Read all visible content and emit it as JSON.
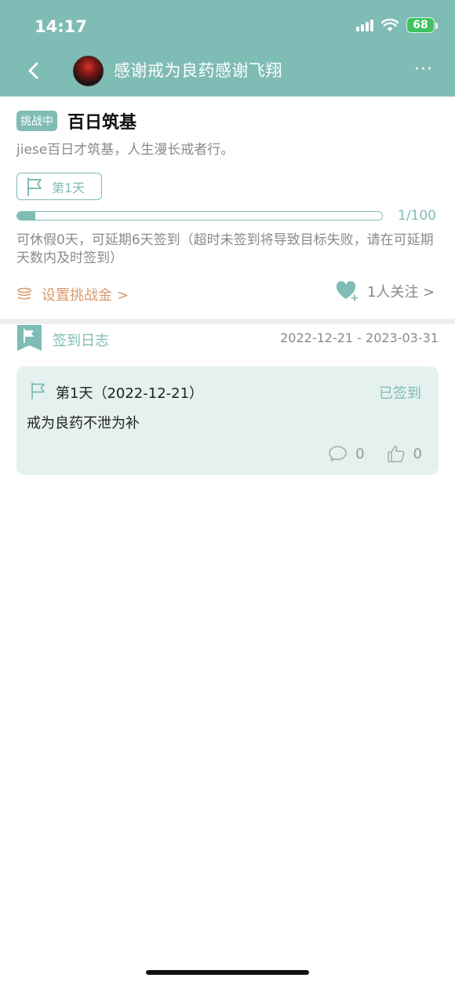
{
  "status_bar": {
    "time": "14:17",
    "battery": "68"
  },
  "nav": {
    "title": "感谢戒为良药感谢飞翔"
  },
  "challenge": {
    "tag": "挑战中",
    "title": "百日筑基",
    "description": "jiese百日才筑基，人生漫长戒者行。",
    "day_label": "第1天",
    "progress_text": "1/100",
    "progress_fraction": 0.05,
    "notice": "可休假0天，可延期6天签到（超时未签到将导致目标失败，请在可延期天数内及时签到）",
    "set_money": "设置挑战金 >",
    "follow": "1人关注 >"
  },
  "log": {
    "title": "签到日志",
    "date_range": "2022-12-21 - 2023-03-31",
    "entries": [
      {
        "day": "第1天（2022-12-21）",
        "status": "已签到",
        "content": "戒为良药不泄为补",
        "comments": "0",
        "likes": "0"
      }
    ]
  },
  "colors": {
    "accent": "#7fbcb5",
    "orange": "#d99a6c",
    "card_bg": "#e5f1ef"
  }
}
